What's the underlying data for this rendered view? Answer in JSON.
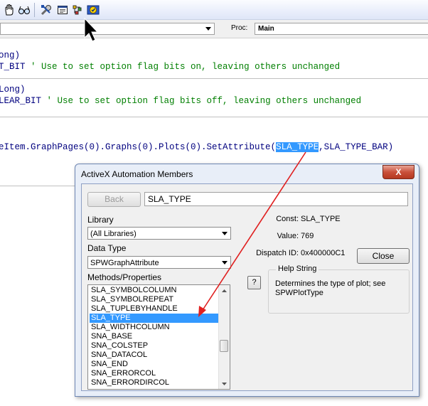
{
  "toolbar": {
    "icons": [
      "hand-icon",
      "glasses-icon",
      "tools-icon",
      "module-icon",
      "object-browser-icon",
      "activex-members-icon"
    ]
  },
  "procbar": {
    "proc_label": "Proc:",
    "proc_value": "Main"
  },
  "code": {
    "line1": "ong)",
    "line2_kw": "T_BIT",
    "line2_comment": " ' Use to set option flag bits on, leaving others unchanged",
    "line3": "Long)",
    "line4_kw": "LEAR_BIT",
    "line4_comment": " ' Use to set option flag bits off, leaving others unchanged",
    "line5_pre": "eItem.GraphPages(0).Graphs(0).Plots(0).SetAttribute(",
    "line5_hl": "SLA_TYPE",
    "line5_post": ",SLA_TYPE_BAR)"
  },
  "dialog": {
    "title": "ActiveX Automation Members",
    "close_glyph": "X",
    "back_label": "Back",
    "member_field": "SLA_TYPE",
    "library_label": "Library",
    "library_value": "(All Libraries)",
    "datatype_label": "Data Type",
    "datatype_value": "SPWGraphAttribute",
    "methods_label": "Methods/Properties",
    "list_items": [
      "SLA_SYMBOLCOLUMN",
      "SLA_SYMBOLREPEAT",
      "SLA_TUPLEBYHANDLE",
      "SLA_TYPE",
      "SLA_WIDTHCOLUMN",
      "SNA_BASE",
      "SNA_COLSTEP",
      "SNA_DATACOL",
      "SNA_END",
      "SNA_ERRORCOL",
      "SNA_ERRORDIRCOL"
    ],
    "selected_item": "SLA_TYPE",
    "const_label": "Const:",
    "const_value": "SLA_TYPE",
    "value_label": "Value:",
    "value_value": "769",
    "dispatch_label": "Dispatch ID:",
    "dispatch_value": "0x400000C1",
    "close_button_label": "Close",
    "help_button_label": "?",
    "help_group_title": "Help String",
    "help_text": "Determines the type of plot; see SPWPlotType"
  },
  "colors": {
    "selection": "#3399ff",
    "keyword": "#00007f",
    "comment": "#007f00",
    "arrow": "#e02020"
  }
}
